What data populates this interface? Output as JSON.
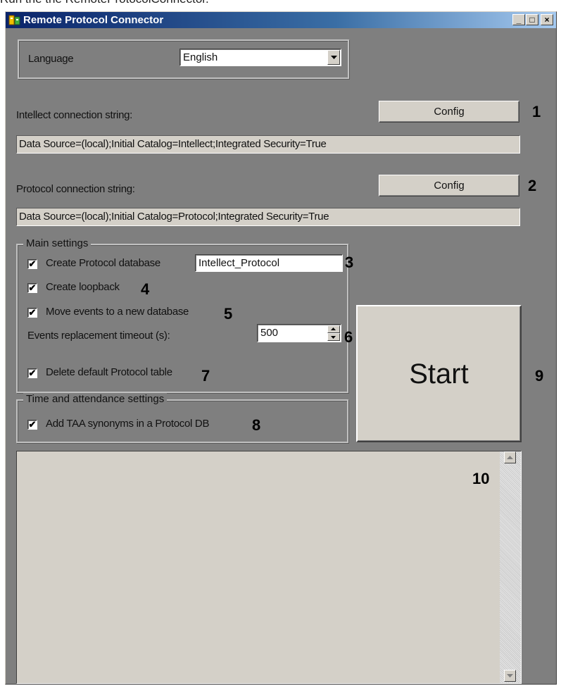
{
  "caption": "Run the the RemoteProtocolConnector.",
  "window": {
    "title": "Remote Protocol Connector",
    "controls": [
      "_",
      "□",
      "×"
    ]
  },
  "language": {
    "label": "Language",
    "selected": "English"
  },
  "intellect": {
    "label": "Intellect connection string:",
    "button": "Config",
    "value": "Data Source=(local);Initial Catalog=Intellect;Integrated Security=True"
  },
  "protocol": {
    "label": "Protocol connection string:",
    "button": "Config",
    "value": "Data Source=(local);Initial Catalog=Protocol;Integrated Security=True"
  },
  "main_settings": {
    "title": "Main settings",
    "create_db": {
      "label": "Create Protocol database",
      "checked": true,
      "db_name": "Intellect_Protocol"
    },
    "create_loopback": {
      "label": "Create loopback",
      "checked": true
    },
    "move_events": {
      "label": "Move events to a new database",
      "checked": true
    },
    "timeout": {
      "label": "Events replacement timeout (s):",
      "value": "500"
    },
    "delete_table": {
      "label": "Delete default Protocol table",
      "checked": true
    }
  },
  "taa_settings": {
    "title": "Time and attendance settings",
    "add_synonyms": {
      "label": "Add TAA synonyms in a Protocol DB",
      "checked": true
    }
  },
  "start_button": "Start",
  "callouts": [
    "1",
    "2",
    "3",
    "4",
    "5",
    "6",
    "7",
    "8",
    "9",
    "10"
  ],
  "colors": {
    "title_bar": "#0a246a",
    "client_bg": "#7f7f7f",
    "control_bg": "#d4d0c8"
  }
}
